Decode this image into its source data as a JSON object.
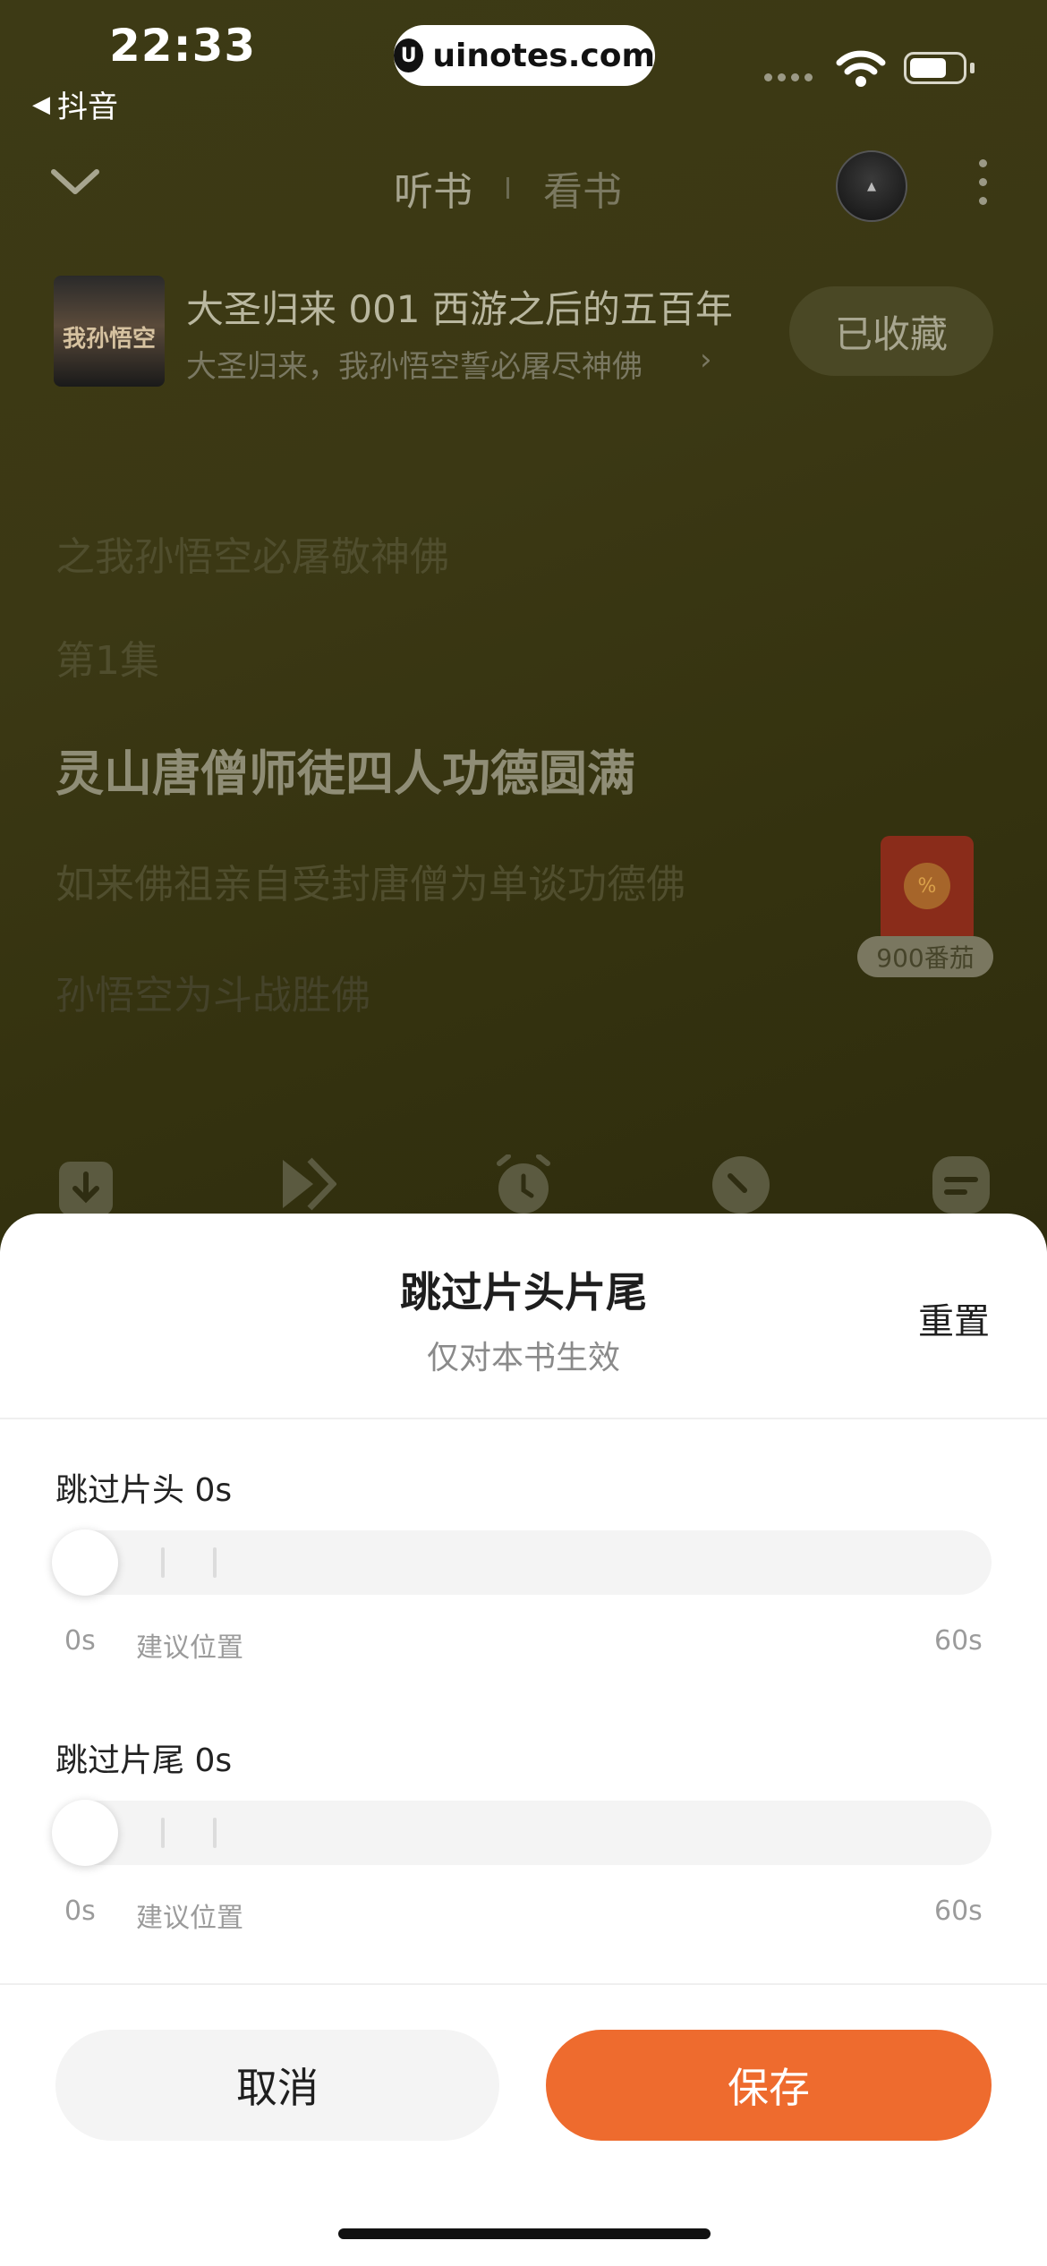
{
  "status_bar": {
    "time": "22:33",
    "back_app": "抖音",
    "url": "uinotes.com"
  },
  "header": {
    "tabs": [
      {
        "label": "听书",
        "active": true
      },
      {
        "label": "看书",
        "active": false
      }
    ]
  },
  "book": {
    "cover_text": "我孙悟空",
    "title": "大圣归来 001 西游之后的五百年",
    "subtitle": "大圣归来，我孙悟空誓必屠尽神佛",
    "fav_label": "已收藏"
  },
  "lyrics": [
    "之我孙悟空必屠敬神佛",
    "第1集",
    "灵山唐僧师徒四人功德圆满",
    "如来佛祖亲自受封唐僧为单谈功德佛",
    "孙悟空为斗战胜佛"
  ],
  "red_packet": {
    "label": "900番茄"
  },
  "sheet": {
    "title": "跳过片头片尾",
    "subtitle": "仅对本书生效",
    "reset_label": "重置",
    "intro": {
      "label": "跳过片头 0s",
      "value_seconds": 0,
      "min_label": "0s",
      "suggest_label": "建议位置",
      "max_label": "60s"
    },
    "outro": {
      "label": "跳过片尾 0s",
      "value_seconds": 0,
      "min_label": "0s",
      "suggest_label": "建议位置",
      "max_label": "60s"
    },
    "cancel_label": "取消",
    "save_label": "保存"
  },
  "colors": {
    "accent": "#ee6b2e",
    "background": "#3f3c15"
  }
}
